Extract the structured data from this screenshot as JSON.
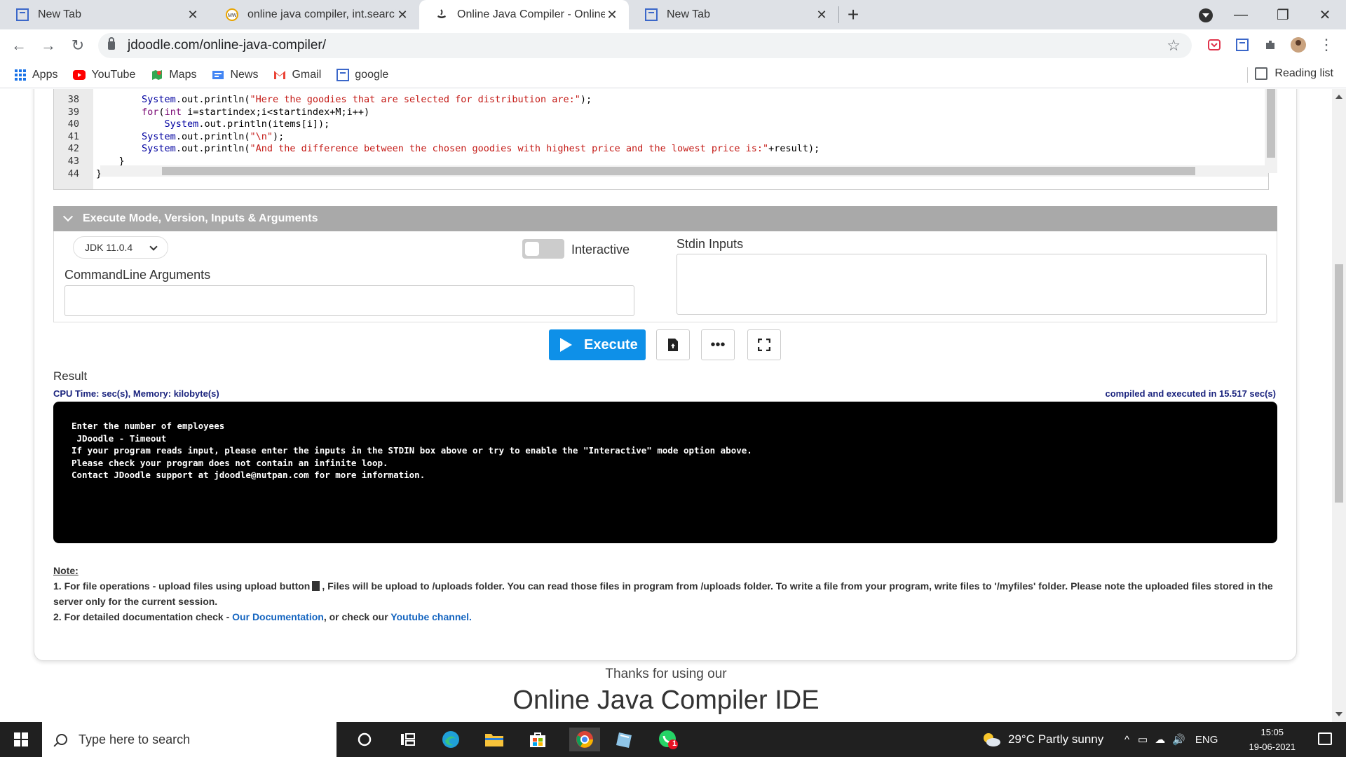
{
  "browser": {
    "tabs": [
      {
        "title": "New Tab",
        "active": false
      },
      {
        "title": "online java compiler, int.search.m",
        "active": false
      },
      {
        "title": "Online Java Compiler - Online Ja",
        "active": true
      },
      {
        "title": "New Tab",
        "active": false
      }
    ],
    "url": "jdoodle.com/online-java-compiler/",
    "bookmarks": [
      "Apps",
      "YouTube",
      "Maps",
      "News",
      "Gmail",
      "google"
    ],
    "reading_list": "Reading list"
  },
  "editor": {
    "lines": [
      {
        "num": "38",
        "text": "        System.out.println(\"Here the goodies that are selected for distribution are:\");"
      },
      {
        "num": "39",
        "text": "        for(int i=startindex;i<startindex+M;i++)"
      },
      {
        "num": "40",
        "text": "            System.out.println(items[i]);"
      },
      {
        "num": "41",
        "text": "        System.out.println(\"\\n\");"
      },
      {
        "num": "42",
        "text": "        System.out.println(\"And the difference between the chosen goodies with highest price and the lowest price is:\"+result);"
      },
      {
        "num": "43",
        "text": "    }"
      },
      {
        "num": "44",
        "text": "}"
      }
    ]
  },
  "execute": {
    "header": "Execute Mode, Version, Inputs & Arguments",
    "jdk_version": "JDK 11.0.4",
    "interactive_label": "Interactive",
    "stdin_label": "Stdin Inputs",
    "cmdline_label": "CommandLine Arguments",
    "execute_label": "Execute"
  },
  "result": {
    "title": "Result",
    "cpu": "CPU Time: sec(s), Memory: kilobyte(s)",
    "compiled": "compiled and executed in 15.517 sec(s)",
    "output": [
      "Enter the number of employees",
      "",
      "",
      "",
      " JDoodle - Timeout",
      "If your program reads input, please enter the inputs in the STDIN box above or try to enable the \"Interactive\" mode option above.",
      "Please check your program does not contain an infinite loop.",
      "Contact JDoodle support at jdoodle@nutpan.com for more information."
    ]
  },
  "note": {
    "heading": "Note:",
    "line1_a": "1. For file operations - upload files using upload button",
    "line1_b": ", Files will be upload to /uploads folder. You can read those files in program from /uploads folder. To write a file from your program, write files to '/myfiles' folder. Please note the uploaded files stored in the server only for the current session.",
    "line2_a": "2. For detailed documentation check - ",
    "line2_link1": "Our Documentation",
    "line2_b": ", or check our ",
    "line2_link2": "Youtube channel."
  },
  "footer": {
    "thanks": "Thanks for using our",
    "title": "Online Java Compiler IDE"
  },
  "taskbar": {
    "search_placeholder": "Type here to search",
    "weather": "29°C  Partly sunny",
    "lang": "ENG",
    "time": "15:05",
    "date": "19-06-2021",
    "whatsapp_badge": "1"
  },
  "colors": {
    "accent": "#0e90e8",
    "exec_header": "#a9a9a9",
    "output_bg": "#000000",
    "link": "#1565c0"
  }
}
